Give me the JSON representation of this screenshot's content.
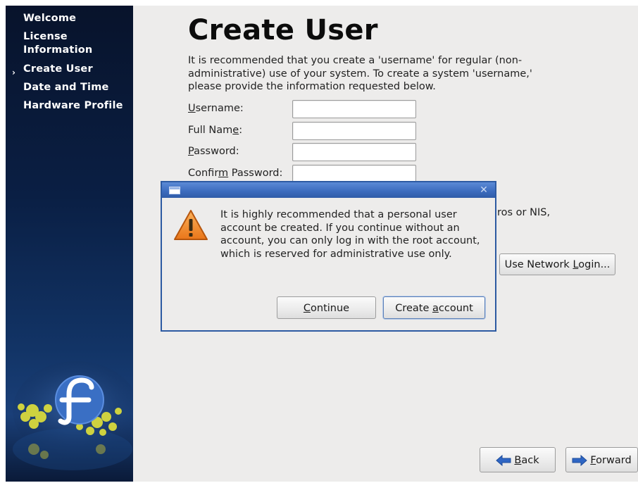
{
  "sidebar": {
    "items": [
      {
        "label": "Welcome"
      },
      {
        "label": "License\nInformation"
      },
      {
        "label": "Create User",
        "current": true
      },
      {
        "label": "Date and Time"
      },
      {
        "label": "Hardware Profile"
      }
    ],
    "current_marker": "›",
    "logo_icon": "fedora-logo-icon"
  },
  "main": {
    "title": "Create User",
    "intro": "It is recommended that you create a 'username' for regular (non-administrative) use of your system. To create a system 'username,' please provide the information requested below.",
    "fields": [
      {
        "label_pre": "",
        "label_mnemonic": "U",
        "label_post": "sername:",
        "value": ""
      },
      {
        "label_pre": "Full Nam",
        "label_mnemonic": "e",
        "label_post": ":",
        "value": ""
      },
      {
        "label_pre": "",
        "label_mnemonic": "P",
        "label_post": "assword:",
        "value": ""
      },
      {
        "label_pre": "Confir",
        "label_mnemonic": "m",
        "label_post": " Password:",
        "value": ""
      }
    ],
    "hint_fragment": "ros or NIS,",
    "network_login_button": {
      "pre": "Use Network ",
      "mnemonic": "L",
      "post": "ogin..."
    }
  },
  "dialog": {
    "icon": "warning-icon",
    "close_icon": "close-icon",
    "message": "It is highly recommended that a personal user account be created.  If you continue without an account, you can only log in with the root account, which is reserved for administrative use only.",
    "continue_button": {
      "pre": "",
      "mnemonic": "C",
      "post": "ontinue"
    },
    "create_button": {
      "pre": "Create ",
      "mnemonic": "a",
      "post": "ccount"
    }
  },
  "footer": {
    "back_button": {
      "pre": "",
      "mnemonic": "B",
      "post": "ack",
      "icon": "arrow-left-icon"
    },
    "forward_button": {
      "pre": "",
      "mnemonic": "F",
      "post": "orward",
      "icon": "arrow-right-icon"
    }
  },
  "colors": {
    "sidebar_bg": "#0a1f44",
    "dialog_border": "#2d5aa2",
    "main_bg": "#edeceb",
    "arrow_blue": "#2f66c4"
  }
}
